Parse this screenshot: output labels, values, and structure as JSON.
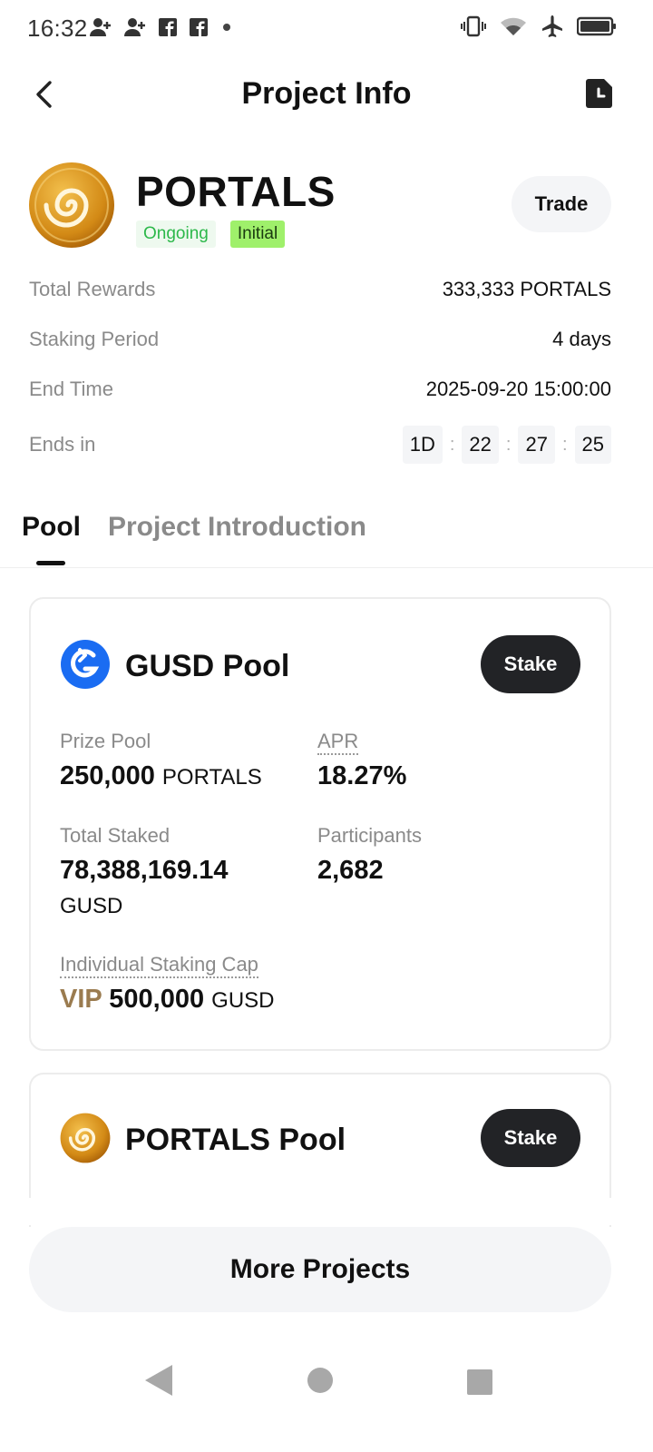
{
  "status_bar": {
    "time": "16:32"
  },
  "header": {
    "title": "Project Info"
  },
  "project": {
    "name": "PORTALS",
    "badge_status": "Ongoing",
    "badge_type": "Initial",
    "trade_label": "Trade"
  },
  "info": {
    "total_rewards_label": "Total Rewards",
    "total_rewards_value": "333,333 PORTALS",
    "staking_period_label": "Staking Period",
    "staking_period_value": "4 days",
    "end_time_label": "End Time",
    "end_time_value": "2025-09-20 15:00:00",
    "ends_in_label": "Ends in",
    "countdown": {
      "days": "1D",
      "hours": "22",
      "minutes": "27",
      "seconds": "25",
      "sep": ":"
    }
  },
  "tabs": {
    "pool": "Pool",
    "introduction": "Project Introduction"
  },
  "gusd_pool": {
    "title": "GUSD Pool",
    "stake_label": "Stake",
    "prize_pool_label": "Prize Pool",
    "prize_pool_value": "250,000",
    "prize_pool_unit": "PORTALS",
    "apr_label": "APR",
    "apr_value": "18.27%",
    "total_staked_label": "Total Staked",
    "total_staked_value": "78,388,169.14",
    "total_staked_unit": "GUSD",
    "participants_label": "Participants",
    "participants_value": "2,682",
    "cap_label": "Individual Staking Cap",
    "cap_vip": "VIP",
    "cap_value": "500,000",
    "cap_unit": "GUSD"
  },
  "portals_pool": {
    "title": "PORTALS Pool",
    "stake_label": "Stake"
  },
  "footer": {
    "more_projects": "More Projects"
  },
  "colors": {
    "ongoing_green": "#2cb84a",
    "initial_green": "#9ff06b",
    "stake_button": "#222326",
    "vip_gold": "#9a7b4f",
    "gusd_blue": "#1a6cf2"
  }
}
